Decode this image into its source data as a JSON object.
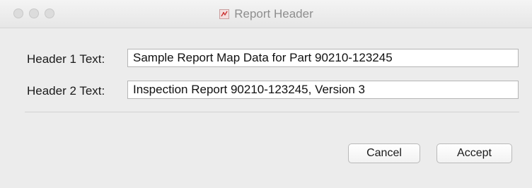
{
  "window": {
    "title": "Report Header",
    "title_icon": "report-document-icon"
  },
  "form": {
    "header1": {
      "label": "Header 1 Text:",
      "value": "Sample Report Map Data for Part 90210-123245"
    },
    "header2": {
      "label": "Header 2 Text:",
      "value": "Inspection Report 90210-123245, Version 3"
    }
  },
  "buttons": {
    "cancel_label": "Cancel",
    "accept_label": "Accept"
  }
}
